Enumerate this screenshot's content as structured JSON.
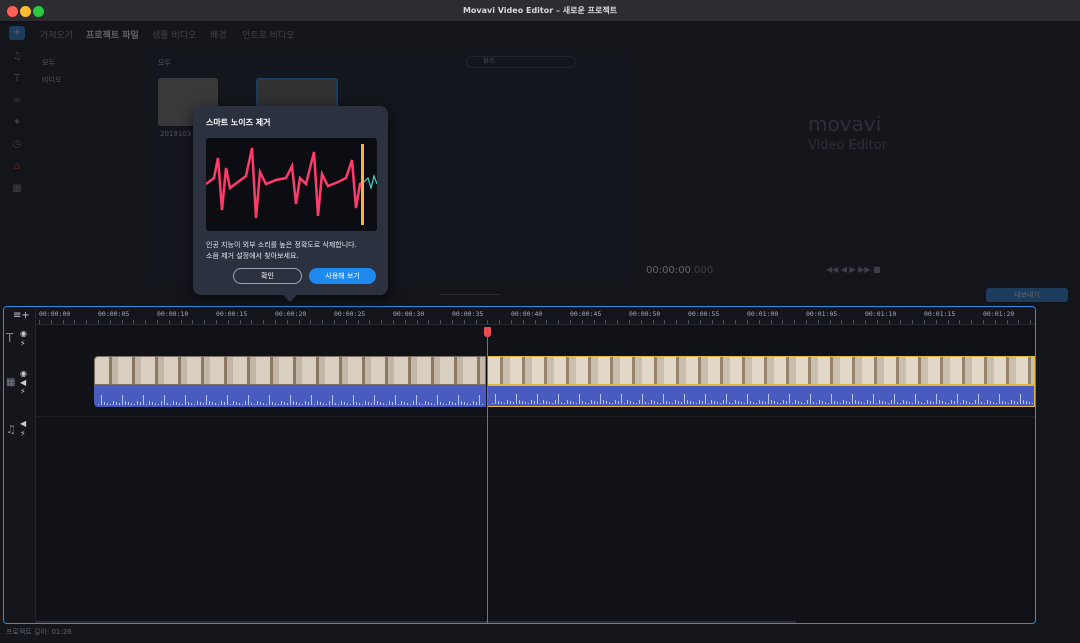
{
  "window": {
    "title": "Movavi Video Editor – 새로운 프로젝트"
  },
  "tabs": [
    "가져오기",
    "프로젝트 파일",
    "샘플 비디오",
    "배경",
    "인트로 비디오"
  ],
  "media": {
    "categories": [
      "모두",
      "비디오"
    ],
    "header": "모두",
    "search_placeholder": "찾기",
    "file_name": "2019103"
  },
  "preview": {
    "logo": "movavi",
    "logo_sub": "Video Editor",
    "timecode": "00:00:00",
    "timecode_frac": ".000"
  },
  "export_button": "내보내기",
  "ruler": [
    "00:00:00",
    "00:00:05",
    "00:00:10",
    "00:00:15",
    "00:00:20",
    "00:00:25",
    "00:00:30",
    "00:00:35",
    "00:00:40",
    "00:00:45",
    "00:00:50",
    "00:00:55",
    "00:01:00",
    "00:01:05",
    "00:01:10",
    "00:01:15",
    "00:01:20"
  ],
  "popup": {
    "title": "스마트 노이즈 제거",
    "line1": "인공 지능이 외부 소리를 높은 정확도로 삭제합니다.",
    "line2": "소음 제거 설정에서 찾아보세요.",
    "ok": "확인",
    "try": "사용해 보기"
  },
  "status": {
    "duration": "프로젝트 길이: 01:26"
  },
  "colors": {
    "accent": "#1e8af0",
    "playhead": "#e0474c",
    "clip_selected": "#e2b83a",
    "audio_clip": "#4a5bbf"
  }
}
